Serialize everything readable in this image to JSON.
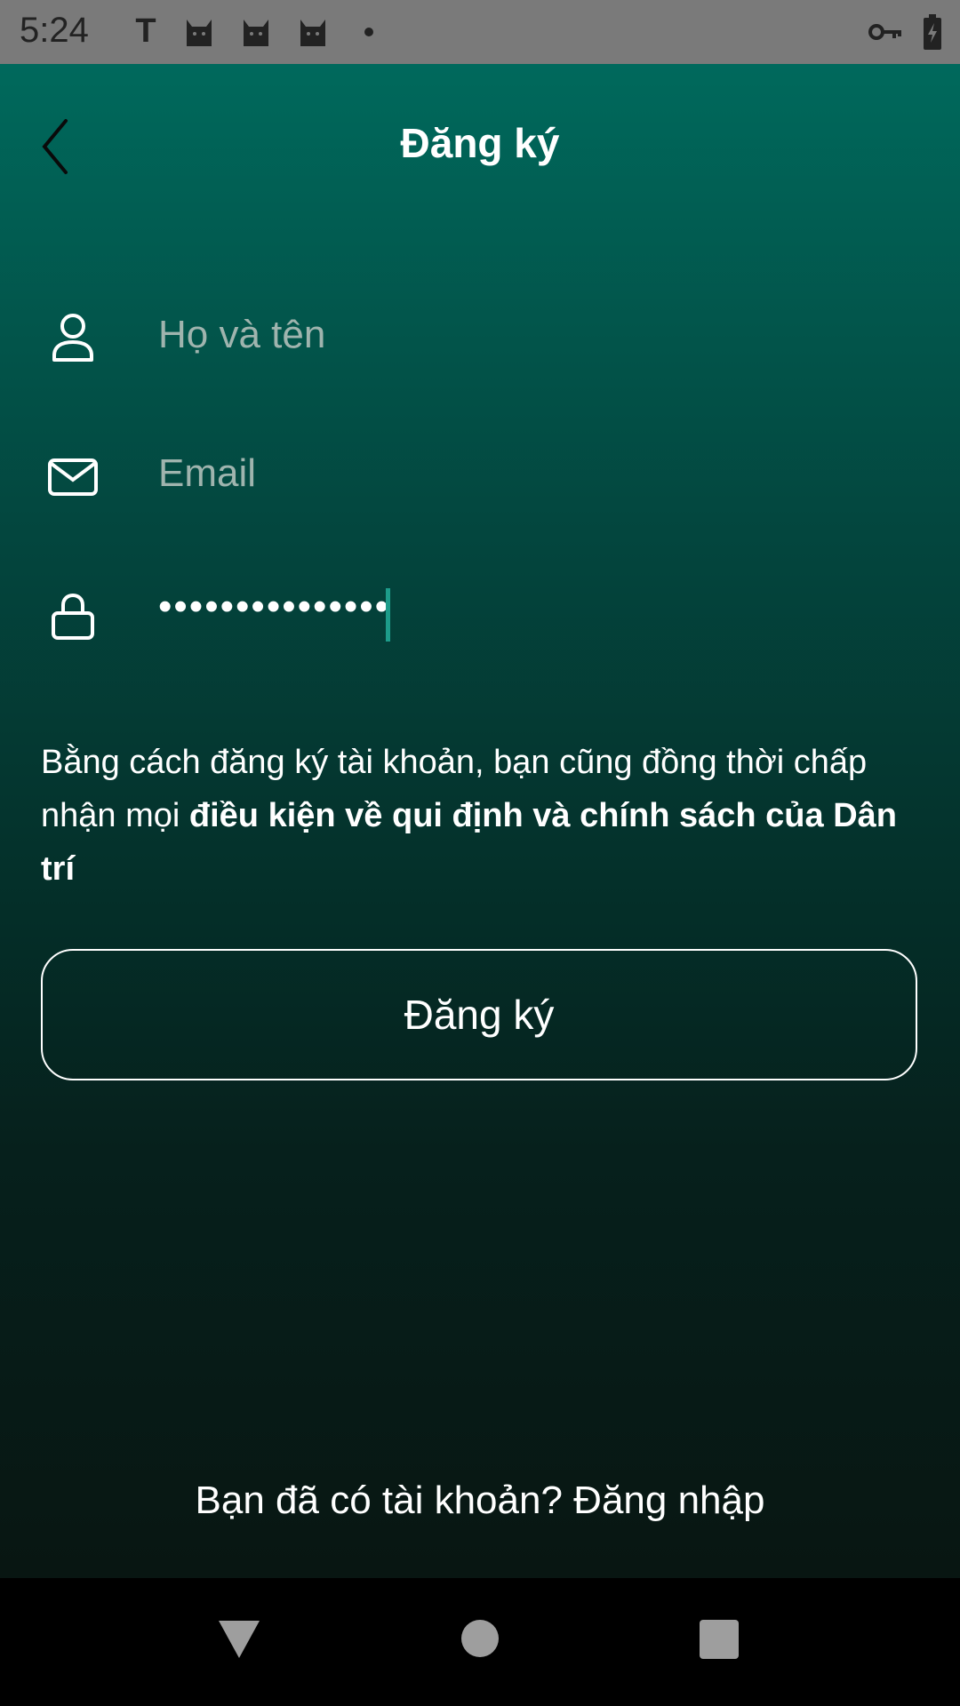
{
  "status_bar": {
    "time": "5:24",
    "notification_letter": "T",
    "icons": [
      "cat-icon",
      "cat-icon",
      "cat-icon",
      "dot-icon",
      "key-icon",
      "battery-charging-icon"
    ]
  },
  "header": {
    "title": "Đăng ký",
    "back_icon": "chevron-left-icon"
  },
  "form": {
    "name_placeholder": "Họ và tên",
    "email_placeholder": "Email",
    "password_value": "•••••••••••••••",
    "name_icon": "user-icon",
    "email_icon": "mail-icon",
    "password_icon": "lock-icon"
  },
  "terms": {
    "prefix": "Bằng cách đăng ký tài khoản, bạn cũng đồng thời chấp nhận mọi ",
    "link": "điều kiện về qui định và chính sách của Dân trí"
  },
  "register_button": "Đăng ký",
  "login_prompt": "Bạn đã có tài khoản? Đăng nhập",
  "nav": {
    "back": "triangle-back-icon",
    "home": "circle-home-icon",
    "recents": "square-recents-icon"
  },
  "colors": {
    "gradient_top": "#00695c",
    "gradient_bottom": "#081612",
    "caret": "#1d9c8a",
    "status_bar": "#7a7a7a"
  }
}
